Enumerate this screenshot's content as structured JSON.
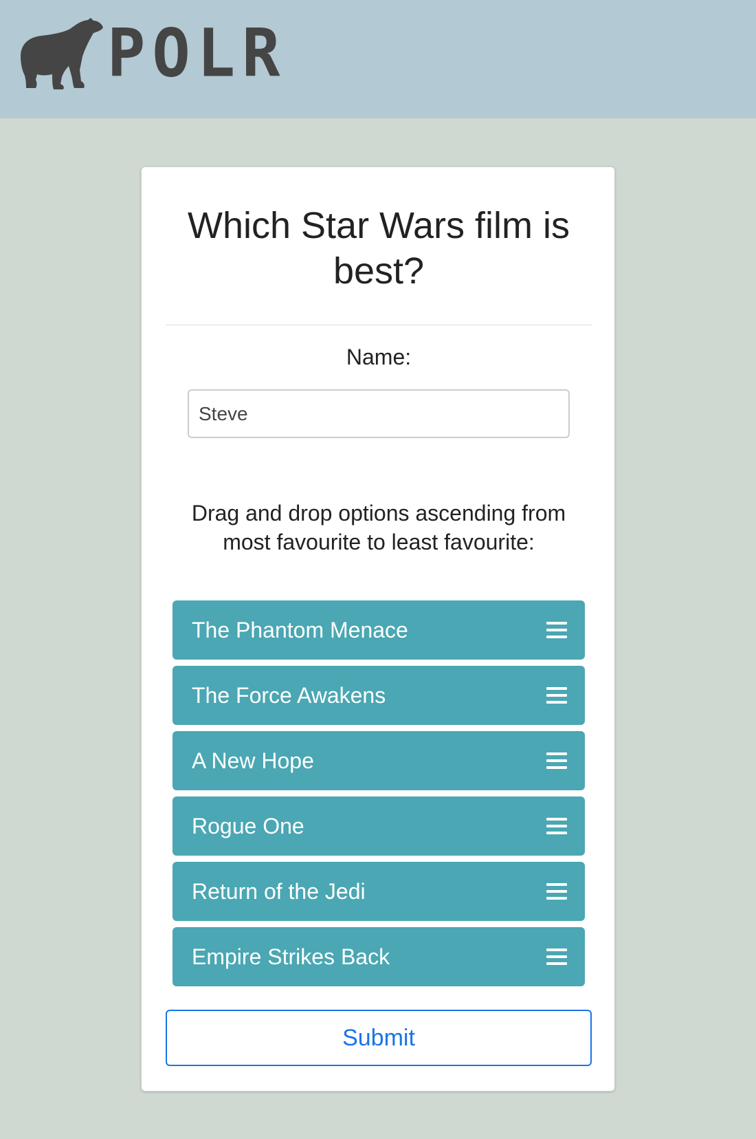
{
  "header": {
    "logo_text": "POLR",
    "logo_icon": "polar-bear-icon",
    "background_color": "#b3c9d3"
  },
  "poll": {
    "title": "Which Star Wars film is best?",
    "name_label": "Name:",
    "name_value": "Steve",
    "instructions": "Drag and drop options ascending from most favourite to least favourite:",
    "options": [
      {
        "label": "The Phantom Menace"
      },
      {
        "label": "The Force Awakens"
      },
      {
        "label": "A New Hope"
      },
      {
        "label": "Rogue One"
      },
      {
        "label": "Return of the Jedi"
      },
      {
        "label": "Empire Strikes Back"
      }
    ],
    "option_color": "#4aa7b3",
    "handle_icon": "drag-handle-icon",
    "submit_label": "Submit",
    "accent_color": "#1a73e8"
  }
}
